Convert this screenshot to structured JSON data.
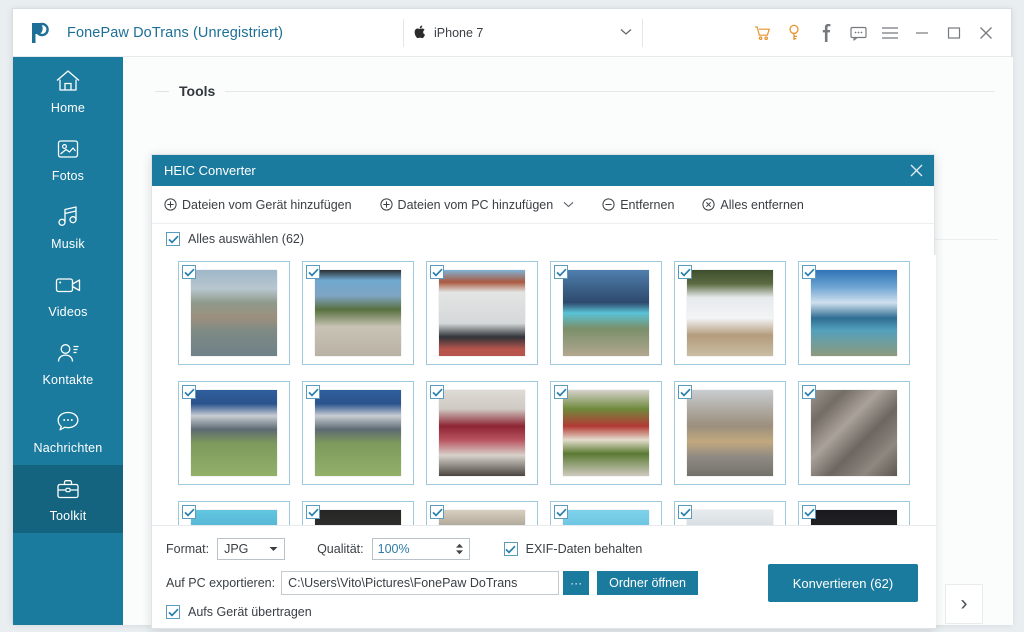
{
  "titlebar": {
    "app_title": "FonePaw DoTrans (Unregistriert)",
    "logo_icon": "fonepaw-logo-icon",
    "device": {
      "apple_glyph": "",
      "name": "iPhone 7",
      "caret": "⌄"
    },
    "window_icons": [
      {
        "name": "cart-icon",
        "color": "#e8922c"
      },
      {
        "name": "key-icon",
        "color": "#e8922c"
      },
      {
        "name": "facebook-icon",
        "color": "#76797d"
      },
      {
        "name": "feedback-icon",
        "color": "#76797d"
      },
      {
        "name": "menu-icon",
        "color": "#76797d"
      },
      {
        "name": "minimize-icon",
        "color": "#76797d"
      },
      {
        "name": "maximize-icon",
        "color": "#76797d"
      },
      {
        "name": "close-icon",
        "color": "#76797d"
      }
    ]
  },
  "sidebar": {
    "items": [
      {
        "label": "Home",
        "icon": "home-icon",
        "active": false
      },
      {
        "label": "Fotos",
        "icon": "photos-icon",
        "active": false
      },
      {
        "label": "Musik",
        "icon": "music-icon",
        "active": false
      },
      {
        "label": "Videos",
        "icon": "video-icon",
        "active": false
      },
      {
        "label": "Kontakte",
        "icon": "contacts-icon",
        "active": false
      },
      {
        "label": "Nachrichten",
        "icon": "messages-icon",
        "active": false
      },
      {
        "label": "Toolkit",
        "icon": "toolkit-icon",
        "active": true
      }
    ]
  },
  "content": {
    "tools_title": "Tools",
    "next_arrow": "›"
  },
  "dialog": {
    "title": "HEIC Converter",
    "close_icon": "close-icon",
    "toolbar": [
      {
        "label": "Dateien vom Gerät hinzufügen",
        "icon": "plus-circle-icon",
        "has_caret": false
      },
      {
        "label": "Dateien vom PC hinzufügen",
        "icon": "plus-circle-icon",
        "has_caret": true,
        "caret": "⌄"
      },
      {
        "label": "Entfernen",
        "icon": "minus-circle-icon",
        "has_caret": false
      },
      {
        "label": "Alles entfernen",
        "icon": "x-circle-icon",
        "has_caret": false
      }
    ],
    "select_all": {
      "label": "Alles auswählen (62)",
      "checked": true
    },
    "thumbnails": [
      {
        "alt": "Lyon riverside cityscape",
        "checked": true,
        "theme": "city-river"
      },
      {
        "alt": "Lyon basilica hillside",
        "checked": true,
        "theme": "city-hill"
      },
      {
        "alt": "Haussmann building facade",
        "checked": true,
        "theme": "city-facade"
      },
      {
        "alt": "Mountain lake panorama",
        "checked": true,
        "theme": "mountain-lake"
      },
      {
        "alt": "Waterfall in forest",
        "checked": true,
        "theme": "waterfall"
      },
      {
        "alt": "Coastal bay with clouds",
        "checked": true,
        "theme": "coast-sky"
      },
      {
        "alt": "Dolomites green valley",
        "checked": true,
        "theme": "alps-valley"
      },
      {
        "alt": "Dolomites green valley",
        "checked": true,
        "theme": "alps-valley"
      },
      {
        "alt": "Red velvet roll cake",
        "checked": true,
        "theme": "dessert"
      },
      {
        "alt": "Mixed salad bowl",
        "checked": true,
        "theme": "salad"
      },
      {
        "alt": "Old town street with market",
        "checked": true,
        "theme": "street"
      },
      {
        "alt": "Weathered wood texture",
        "checked": true,
        "theme": "wood"
      },
      {
        "alt": "Sea horizon",
        "checked": true,
        "theme": "sea-strip"
      },
      {
        "alt": "Dark interior",
        "checked": true,
        "theme": "dark-strip"
      },
      {
        "alt": "Architecture detail",
        "checked": true,
        "theme": "arch-strip"
      },
      {
        "alt": "Blue water",
        "checked": true,
        "theme": "blue-strip"
      },
      {
        "alt": "Snow mountain",
        "checked": true,
        "theme": "snow-strip"
      },
      {
        "alt": "Night scene",
        "checked": true,
        "theme": "night-strip"
      }
    ],
    "options": {
      "format_label": "Format:",
      "format_value": "JPG",
      "format_caret": "▼",
      "quality_label": "Qualität:",
      "quality_value": "100%",
      "exif": {
        "label": "EXIF-Daten behalten",
        "checked": true
      },
      "export_label": "Auf PC exportieren:",
      "export_path": "C:\\Users\\Vito\\Pictures\\FonePaw DoTrans",
      "browse_label": "···",
      "open_folder_label": "Ordner öffnen",
      "transfer": {
        "label": "Aufs Gerät übertragen",
        "checked": true
      },
      "convert_label": "Konvertieren (62)"
    }
  },
  "colors": {
    "brand_blue": "#1b7b9e",
    "active_blue": "#15647f",
    "accent_orange": "#e8922c",
    "checkbox_blue": "#2a7fae"
  }
}
